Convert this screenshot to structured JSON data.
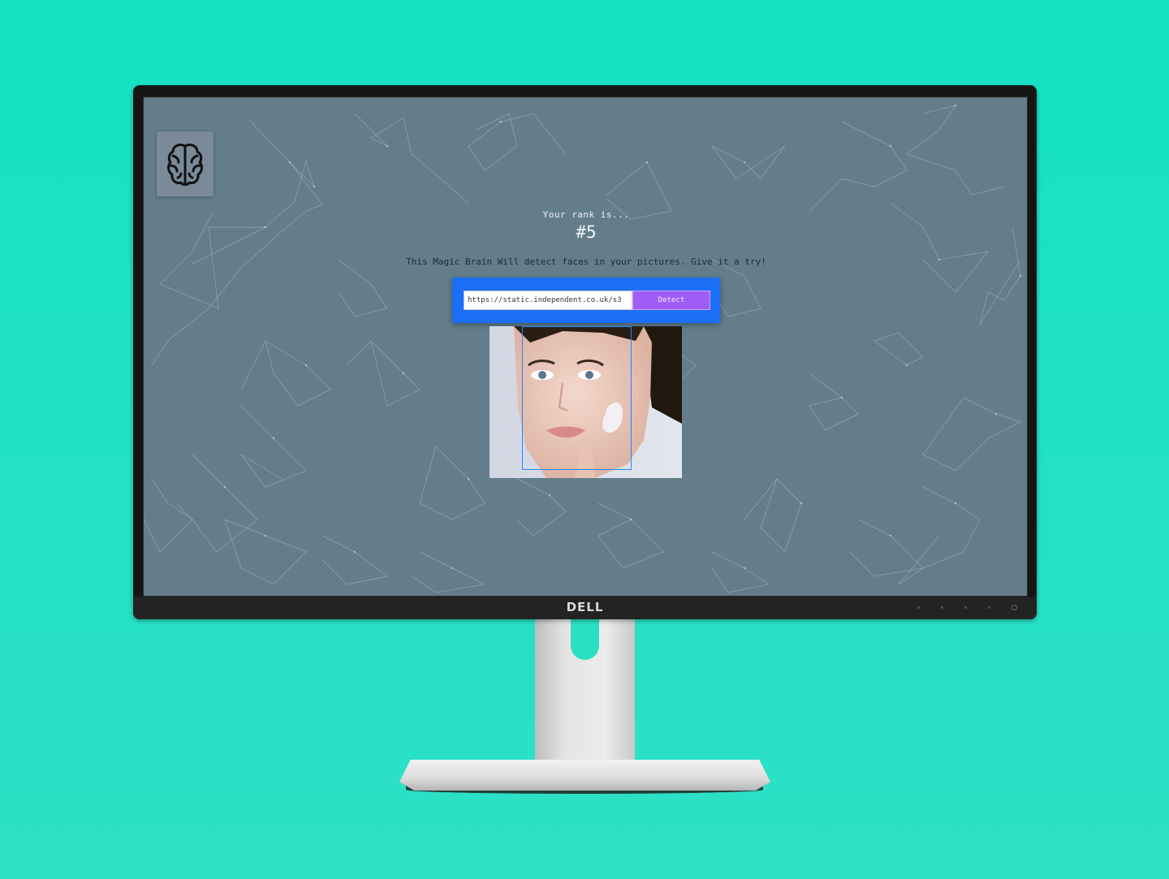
{
  "app": {
    "logo_icon": "brain-icon",
    "rank_label": "Your rank is...",
    "rank_value": "#5",
    "tagline": "This Magic Brain Will detect faces in your pictures. Give it a try!"
  },
  "form": {
    "url_value": "https://static.independent.co.uk/s3",
    "detect_label": "Detect"
  },
  "monitor": {
    "brand": "DELL"
  },
  "colors": {
    "background": "#14e2c3",
    "screen": "#637d8b",
    "form_card": "#1b6ff7",
    "detect_button": "#a05df5",
    "face_box": "#1e88ff"
  }
}
